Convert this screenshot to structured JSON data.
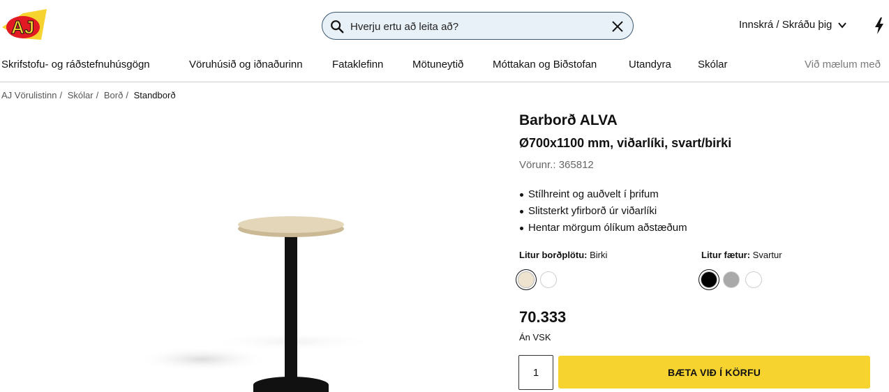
{
  "header": {
    "logo_text": "AJ",
    "search_placeholder": "Hverju ertu að leita að?",
    "login_label": "Innskrá / Skráðu þig"
  },
  "nav": {
    "items": [
      "Skrifstofu- og ráðstefnuhúsgögn",
      "Vöruhúsið og iðnaðurinn",
      "Fataklefinn",
      "Mötuneytið",
      "Móttakan og Biðstofan",
      "Utandyra",
      "Skólar",
      "Við mælum með"
    ]
  },
  "breadcrumb": [
    "AJ Vörulistinn",
    "Skólar",
    "Borð",
    "Standborð"
  ],
  "product": {
    "title": "Barborð ALVA",
    "subtitle": "Ø700x1100 mm, viðarlíki, svart/birki",
    "sku": "Vörunr.: 365812",
    "bullets": [
      "Stílhreint og auðvelt í þrifum",
      "Slitsterkt yfirborð úr viðarlíki",
      "Hentar mörgum ólíkum aðstæðum"
    ],
    "top_color_label": "Litur borðplötu:",
    "top_color_value": "Birki",
    "leg_color_label": "Litur fætur:",
    "leg_color_value": "Svartur",
    "price": "70.333",
    "vat_note": "Án VSK",
    "quantity": "1",
    "cart_label": "BÆTA VIÐ Í KÖRFU"
  },
  "colors": {
    "accent_yellow": "#f7d32f",
    "search_bg": "#e9f1f8",
    "swatch_birch": "#ede3cf",
    "swatch_white": "#ffffff",
    "swatch_black": "#000000",
    "swatch_grey": "#a9a9a9"
  }
}
